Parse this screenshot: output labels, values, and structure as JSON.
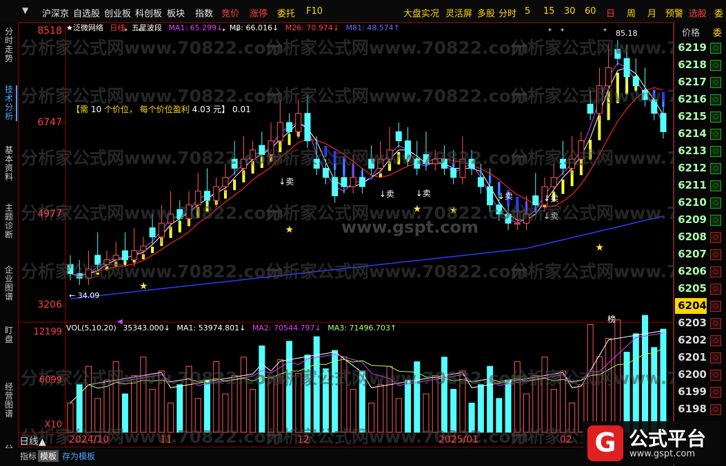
{
  "topbar": {
    "items": [
      {
        "label": "沪深京",
        "x": 61,
        "cls": ""
      },
      {
        "label": "自选股",
        "x": 106,
        "cls": ""
      },
      {
        "label": "创业板",
        "x": 151,
        "cls": ""
      },
      {
        "label": "科创板",
        "x": 196,
        "cls": ""
      },
      {
        "label": "板块",
        "x": 242,
        "cls": ""
      },
      {
        "label": "指数",
        "x": 283,
        "cls": ""
      },
      {
        "label": "竞价",
        "x": 321,
        "cls": "red"
      },
      {
        "label": "涨停",
        "x": 362,
        "cls": "red"
      },
      {
        "label": "委托",
        "x": 402,
        "cls": "yellow"
      },
      {
        "label": "F10",
        "x": 444,
        "cls": "yellow"
      },
      {
        "label": "大盘实况",
        "x": 585,
        "cls": "yellow"
      },
      {
        "label": "灵活屏",
        "x": 646,
        "cls": "yellow"
      },
      {
        "label": "多股",
        "x": 692,
        "cls": "yellow"
      },
      {
        "label": "分时",
        "x": 723,
        "cls": "yellow"
      },
      {
        "label": "5",
        "x": 761,
        "cls": "yellow"
      },
      {
        "label": "15",
        "x": 788,
        "cls": "yellow"
      },
      {
        "label": "30",
        "x": 818,
        "cls": "yellow"
      },
      {
        "label": "60",
        "x": 848,
        "cls": "yellow"
      },
      {
        "label": "日",
        "x": 879,
        "cls": "active"
      },
      {
        "label": "周",
        "x": 909,
        "cls": "yellow"
      },
      {
        "label": "月",
        "x": 939,
        "cls": "yellow"
      },
      {
        "label": "预警",
        "x": 965,
        "cls": "yellow"
      },
      {
        "label": "选股",
        "x": 999,
        "cls": "red"
      },
      {
        "label": "委",
        "x": 1036,
        "cls": "yellow"
      }
    ]
  },
  "lefttabs": [
    {
      "label": "分时走势",
      "top": 40,
      "active": false
    },
    {
      "label": "技术分析",
      "top": 124,
      "active": true
    },
    {
      "label": "基本资料",
      "top": 212,
      "active": false
    },
    {
      "label": "主题诊断",
      "top": 296,
      "active": false
    },
    {
      "label": "企业图谱",
      "top": 386,
      "active": false
    },
    {
      "label": "盯盘",
      "top": 474,
      "active": false
    },
    {
      "label": "经营图谱",
      "top": 556,
      "active": false
    },
    {
      "label": "分时",
      "top": 646,
      "active": false
    }
  ],
  "legend": {
    "title": "★泛微网络",
    "period": "日线",
    "indicator": "五星波段",
    "ma1": "MA1: 65.299↓",
    "m8": "M8: 66.016↓",
    "m26": "M26: 70.974↓",
    "m81": "M81: 48.574↑"
  },
  "vol_legend": {
    "vol": "VOL(5,10,20)",
    "v": "35343.000↓",
    "ma1": "MA1: 53974.801↓",
    "ma2": "MA2: 70544.797↓",
    "ma3": "MA3: 71496.703↑"
  },
  "profit_note": {
    "open": "【需",
    "count": "10",
    "mid": "个价位，",
    "each": "每个价位盈利",
    "amt": "4.03 元】",
    "tail": "0.01"
  },
  "y_axis": [
    "8518",
    "6747",
    "4977",
    "3206"
  ],
  "vol_axis": [
    "12199",
    "6099"
  ],
  "vol_multiplier": "X10",
  "annotations": {
    "high": "85.18",
    "low": "← 34.09",
    "sell": "卖",
    "rank": "榜"
  },
  "x_labels": [
    "2024/10",
    "11",
    "12",
    "2025/01",
    "02"
  ],
  "day_label": "日线▲",
  "bottom_tabs": [
    "指标",
    "模板",
    "存为模板"
  ],
  "ladder": {
    "header": "价格",
    "header2": "委",
    "prices": [
      "6219",
      "6218",
      "6217",
      "6216",
      "6215",
      "6214",
      "6213",
      "6212",
      "6211",
      "6210",
      "6209",
      "6208",
      "6207",
      "6206",
      "6205",
      "6204",
      "6203",
      "6202",
      "6201",
      "6200",
      "6199",
      "6198"
    ],
    "current": "6204"
  },
  "watermark": "分析家公式网www.70822.com",
  "watermark2": "www.gspt.com",
  "logo": {
    "mark": "G",
    "name": "公式平台",
    "url": "www.gspt.com"
  },
  "colors": {
    "up": "#ff5a5a",
    "down": "#54ffff",
    "ma_white": "#ffffff",
    "ma_purple": "#e040fb",
    "ma_red": "#ff2020",
    "ma_blue": "#2a3cff",
    "band_yellow": "#ffff33"
  },
  "chart_data": {
    "type": "candlestick",
    "series": [
      {
        "name": "close",
        "values": [
          37,
          36,
          38,
          39,
          40,
          41,
          40,
          42,
          43,
          45,
          48,
          50,
          49,
          52,
          55,
          53,
          56,
          58,
          60,
          62,
          64,
          63,
          66,
          70,
          68,
          72,
          66,
          60,
          58,
          54,
          56,
          58,
          56,
          60,
          62,
          64,
          66,
          62,
          60,
          61,
          62,
          60,
          58,
          62,
          60,
          56,
          52,
          50,
          48,
          48,
          50,
          52,
          56,
          58,
          60,
          62,
          66,
          72,
          78,
          82,
          84,
          80,
          78,
          75,
          72,
          68
        ]
      }
    ]
  }
}
